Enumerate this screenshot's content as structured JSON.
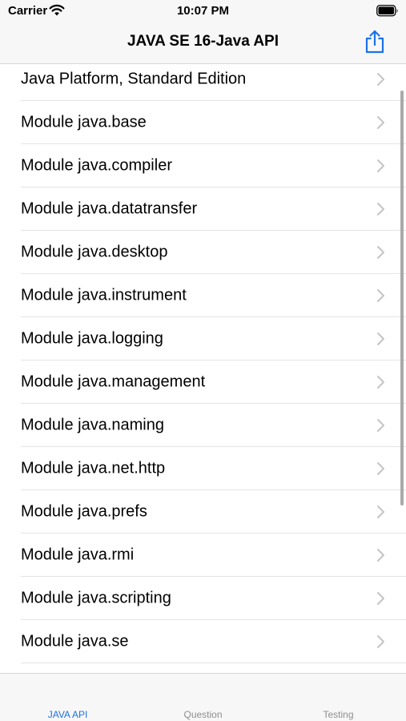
{
  "status_bar": {
    "carrier": "Carrier",
    "time": "10:07 PM"
  },
  "nav": {
    "title": "JAVA SE 16-Java API",
    "share_icon": "share-icon",
    "accent_color": "#1a73e8"
  },
  "list": {
    "items": [
      {
        "label": "Java Platform, Standard Edition"
      },
      {
        "label": "Module java.base"
      },
      {
        "label": "Module java.compiler"
      },
      {
        "label": "Module java.datatransfer"
      },
      {
        "label": "Module java.desktop"
      },
      {
        "label": "Module java.instrument"
      },
      {
        "label": "Module java.logging"
      },
      {
        "label": "Module java.management"
      },
      {
        "label": "Module java.naming"
      },
      {
        "label": "Module java.net.http"
      },
      {
        "label": "Module java.prefs"
      },
      {
        "label": "Module java.rmi"
      },
      {
        "label": "Module java.scripting"
      },
      {
        "label": "Module java.se"
      }
    ]
  },
  "tab_bar": {
    "tabs": [
      {
        "label": "JAVA API",
        "active": true
      },
      {
        "label": "Question",
        "active": false
      },
      {
        "label": "Testing",
        "active": false
      }
    ]
  }
}
